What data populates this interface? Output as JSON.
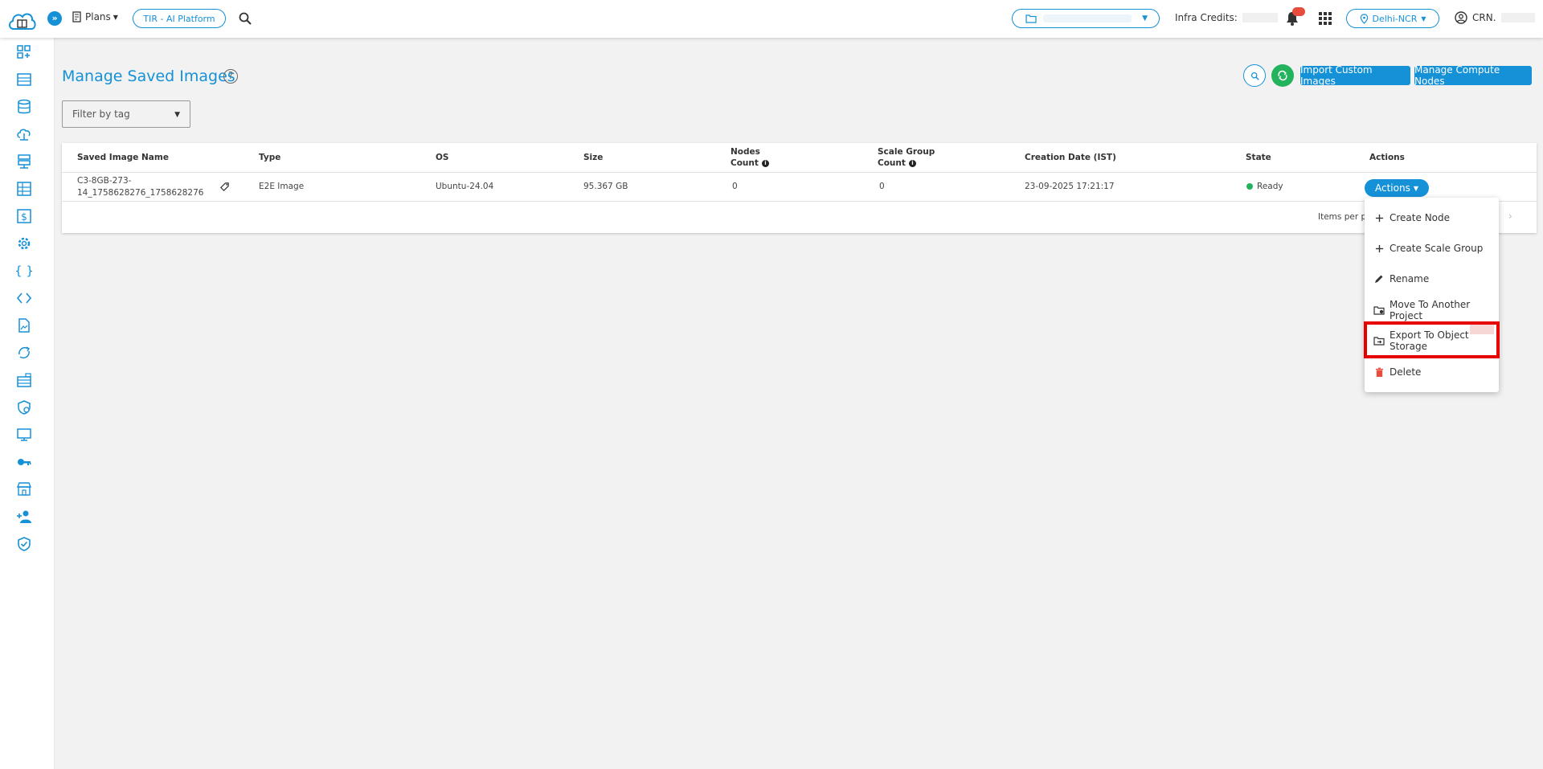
{
  "topbar": {
    "plans_label": "Plans",
    "platform_label": "TIR - AI Platform",
    "credits_label": "Infra Credits:",
    "region_label": "Delhi-NCR",
    "user_label": "CRN."
  },
  "page": {
    "title": "Manage Saved Images",
    "import_button": "Import Custom Images",
    "manage_button": "Manage Compute Nodes",
    "filter_placeholder": "Filter by tag"
  },
  "table": {
    "headers": {
      "name": "Saved Image Name",
      "type": "Type",
      "os": "OS",
      "size": "Size",
      "nodes_line1": "Nodes",
      "nodes_line2": "Count",
      "scale_line1": "Scale Group",
      "scale_line2": "Count",
      "date": "Creation Date (IST)",
      "state": "State",
      "actions": "Actions"
    },
    "rows": [
      {
        "name_line1": "C3-8GB-273-",
        "name_line2": "14_1758628276_1758628276",
        "type": "E2E Image",
        "os": "Ubuntu-24.04",
        "size": "95.367 GB",
        "nodes": "0",
        "scale": "0",
        "date": "23-09-2025 17:21:17",
        "state": "Ready",
        "actions_label": "Actions"
      }
    ],
    "items_per_page": "Items per pa"
  },
  "dropdown": {
    "items": [
      {
        "label": "Create Node",
        "icon": "plus-icon"
      },
      {
        "label": "Create Scale Group",
        "icon": "plus-icon"
      },
      {
        "label": "Rename",
        "icon": "pencil-icon"
      },
      {
        "label": "Move To Another Project",
        "icon": "folder-move-icon"
      },
      {
        "label": "Export To Object Storage",
        "icon": "folder-export-icon"
      },
      {
        "label": "Delete",
        "icon": "trash-icon"
      }
    ]
  },
  "colors": {
    "accent": "#1591d8",
    "success": "#22b35c",
    "danger": "#e74c3c",
    "highlight": "#e60000"
  }
}
